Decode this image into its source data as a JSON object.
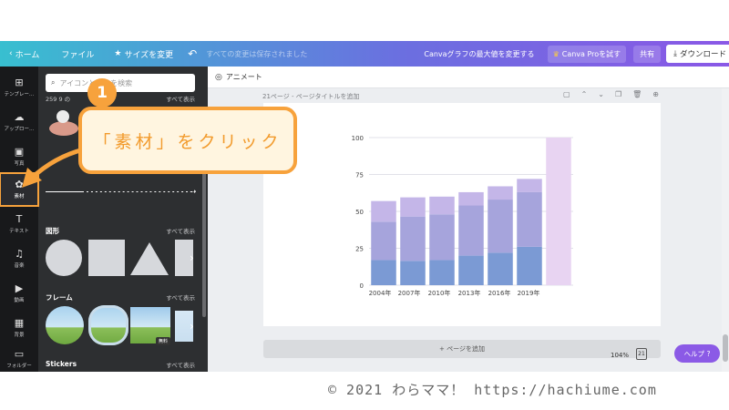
{
  "topbar": {
    "home_label": "ホーム",
    "file_label": "ファイル",
    "resize_label": "サイズを変更",
    "saved_label": "すべての変更は保存されました",
    "max_graph_label": "Canvaグラフの最大値を変更する",
    "pro_label": "Canva Proを試す",
    "share_label": "共有",
    "download_label": "ダウンロード",
    "more_label": "•••"
  },
  "rail": {
    "items": [
      {
        "label": "テンプレー…",
        "icon": "layout-icon",
        "glyph": "⊞"
      },
      {
        "label": "アップロー…",
        "icon": "upload-icon",
        "glyph": "☁"
      },
      {
        "label": "写真",
        "icon": "photo-icon",
        "glyph": "▣"
      },
      {
        "label": "素材",
        "icon": "elements-icon",
        "glyph": "✿"
      },
      {
        "label": "テキスト",
        "icon": "text-icon",
        "glyph": "T"
      },
      {
        "label": "音楽",
        "icon": "music-icon",
        "glyph": "♫"
      },
      {
        "label": "動画",
        "icon": "video-icon",
        "glyph": "▶"
      },
      {
        "label": "背景",
        "icon": "background-icon",
        "glyph": "▦"
      },
      {
        "label": "フォルダー",
        "icon": "folder-icon",
        "glyph": "▭"
      }
    ]
  },
  "panel": {
    "search_placeholder": "アイコンと画像を検索",
    "result_count": "259 9 の",
    "see_all_1": "すべて表示",
    "shapes_title": "図形",
    "see_all_shapes": "すべて表示",
    "frames_title": "フレーム",
    "see_all_frames": "すべて表示",
    "free_badge": "無料",
    "stickers_title": "Stickers",
    "see_all_stickers": "すべて表示"
  },
  "canvas": {
    "animate_label": "アニメート",
    "page_header": "21ページ - ページタイトルを追加",
    "add_page_label": "+ ページを追加",
    "zoom_label": "104%",
    "pages_label": "21",
    "help_label": "ヘルプ ?"
  },
  "callout": {
    "number": "1",
    "text": "「素材」をクリック"
  },
  "footer": {
    "copyright": "© 2021 わらママ！ https://hachiume.com"
  },
  "colors": {
    "accent_orange": "#f7a23c",
    "series_bottom": "#7b9ad4",
    "series_middle": "#a6a4dc",
    "series_top": "#c4b6e8",
    "highlight_bar": "#e8d4f2"
  },
  "chart_data": {
    "type": "bar",
    "stacked": true,
    "categories": [
      "2004年",
      "",
      "2007年",
      "2010年",
      "",
      "2013年",
      "2016年",
      "2019年",
      ""
    ],
    "series": [
      {
        "values": [
          17,
          16.5,
          17,
          20,
          22,
          26,
          0
        ]
      },
      {
        "values": [
          26,
          30,
          31,
          34,
          36,
          37,
          0
        ]
      },
      {
        "values": [
          14,
          13,
          12,
          9,
          9,
          9,
          100
        ]
      }
    ],
    "bar_categories": [
      "2004年",
      "2007年",
      "2010年",
      "2013年",
      "2016年",
      "2019年",
      ""
    ],
    "yticks": [
      0,
      25,
      50,
      75,
      100
    ],
    "ylim": [
      0,
      100
    ],
    "grid": true
  }
}
